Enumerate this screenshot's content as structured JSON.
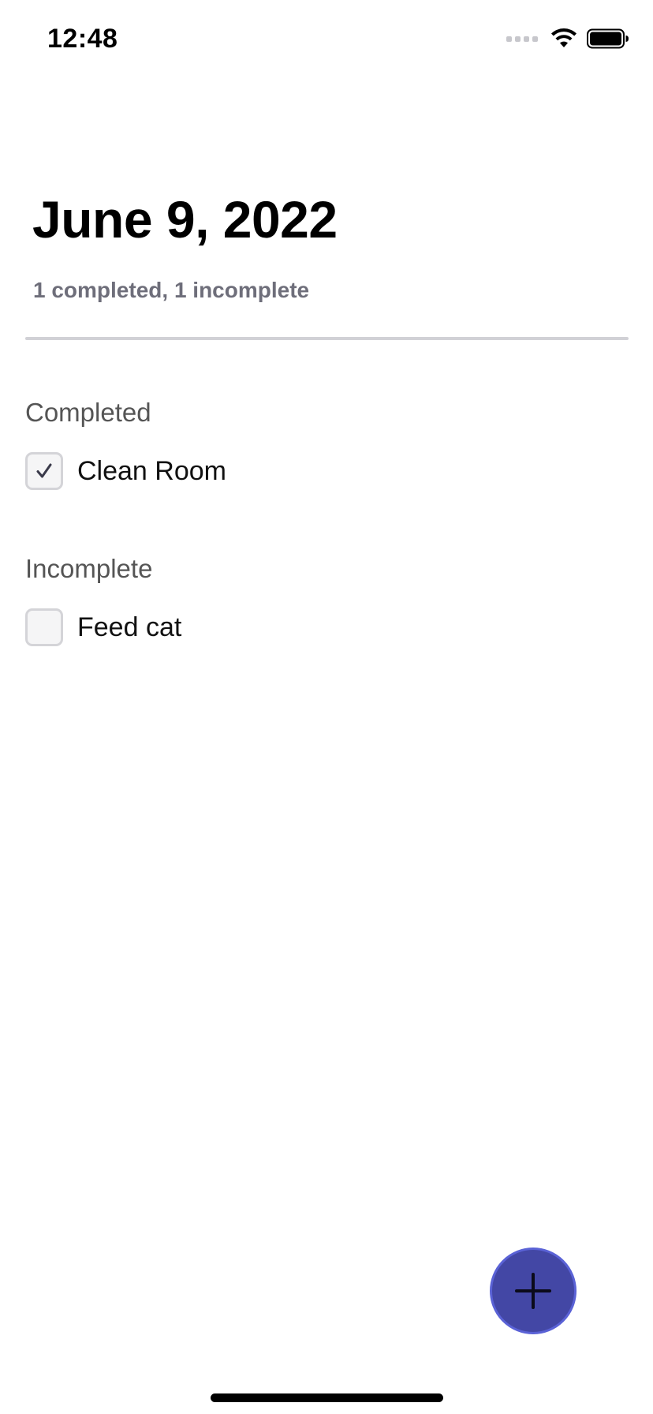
{
  "status_bar": {
    "time": "12:48",
    "icons": [
      "cellular-signal-icon",
      "wifi-icon",
      "battery-icon"
    ]
  },
  "header": {
    "title": "June 9, 2022",
    "subtitle": "1 completed, 1 incomplete"
  },
  "sections": [
    {
      "title": "Completed",
      "tasks": [
        {
          "label": "Clean Room",
          "checked": true
        }
      ]
    },
    {
      "title": "Incomplete",
      "tasks": [
        {
          "label": "Feed cat",
          "checked": false
        }
      ]
    }
  ],
  "fab": {
    "icon": "plus-icon",
    "color": "#4347a5"
  },
  "colors": {
    "accent": "#4347a5",
    "subtitle": "#6e6e7a",
    "section_header": "#555555",
    "divider": "#d1d1d6"
  }
}
